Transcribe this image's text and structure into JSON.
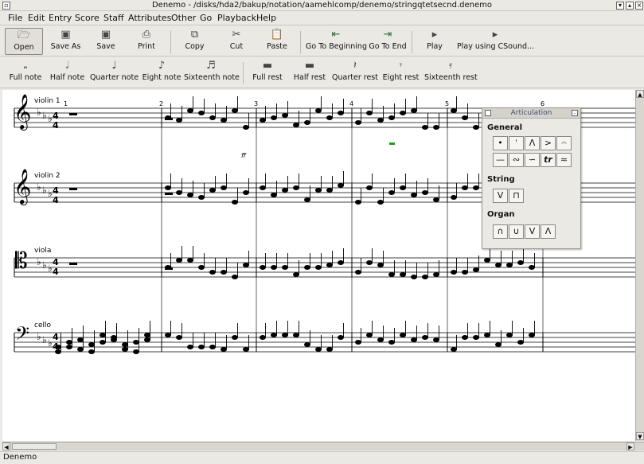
{
  "window": {
    "title": "Denemo - /disks/hda2/bakup/notation/aamehlcomp/denemo/stringqtetsecnd.denemo"
  },
  "menu": [
    "File",
    "Edit",
    "Entry",
    "Score",
    "Staff",
    "Attributes",
    "Other",
    "Go",
    "Playback",
    "Help"
  ],
  "toolbar": {
    "open": "Open",
    "save_as": "Save As",
    "save": "Save",
    "print": "Print",
    "copy": "Copy",
    "cut": "Cut",
    "paste": "Paste",
    "go_beginning": "Go To Beginning",
    "go_end": "Go To End",
    "play": "Play",
    "play_csound": "Play using CSound..."
  },
  "duration_bar": {
    "full_note": "Full note",
    "half_note": "Half note",
    "quarter_note": "Quarter note",
    "eighth_note": "Eight note",
    "sixteenth_note": "Sixteenth note",
    "full_rest": "Full rest",
    "half_rest": "Half rest",
    "quarter_rest": "Quarter rest",
    "eighth_rest": "Eight rest",
    "sixteenth_rest": "Sixteenth rest"
  },
  "score": {
    "staves": [
      "violin 1",
      "violin 2",
      "viola",
      "cello"
    ],
    "measure_numbers": [
      "1",
      "2",
      "3",
      "4",
      "5",
      "6"
    ],
    "dynamic": "ff",
    "time_signature": {
      "top": "4",
      "bottom": "4"
    }
  },
  "articulation_palette": {
    "title": "Articulation",
    "groups": {
      "general": "General",
      "string": "String",
      "organ": "Organ"
    }
  },
  "status": {
    "text": "Denemo"
  }
}
